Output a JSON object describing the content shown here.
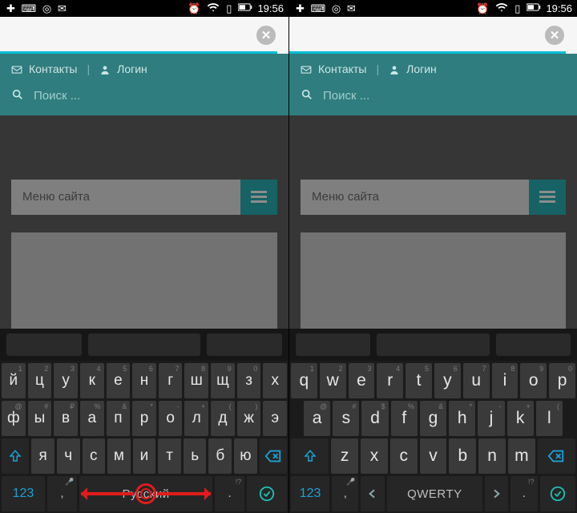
{
  "status": {
    "time": "19:56"
  },
  "header": {
    "contacts": "Контакты",
    "login": "Логин",
    "search_placeholder": "Поиск ..."
  },
  "menu": {
    "title": "Меню сайта"
  },
  "keyboard_ru": {
    "row1_letters": [
      "й",
      "ц",
      "у",
      "к",
      "е",
      "н",
      "г",
      "ш",
      "щ",
      "з",
      "х"
    ],
    "row1_sup": [
      "1",
      "2",
      "3",
      "4",
      "5",
      "6",
      "7",
      "8",
      "9",
      "0",
      ""
    ],
    "row2_letters": [
      "ф",
      "ы",
      "в",
      "а",
      "п",
      "р",
      "о",
      "л",
      "д",
      "ж",
      "э"
    ],
    "row2_sup": [
      "@",
      "#",
      "₽",
      "%",
      "&",
      "*",
      "-",
      "+",
      "(",
      ")",
      ""
    ],
    "row3_letters": [
      "я",
      "ч",
      "с",
      "м",
      "и",
      "т",
      "ь",
      "б",
      "ю"
    ],
    "row3_sup": [
      "",
      "",
      "",
      "",
      "",
      "",
      "",
      "",
      ""
    ],
    "fn123": "123",
    "comma": ",",
    "space_label": "Русский",
    "period": ".",
    "question_sup": "!?"
  },
  "keyboard_en": {
    "row1_letters": [
      "q",
      "w",
      "e",
      "r",
      "t",
      "y",
      "u",
      "i",
      "o",
      "p"
    ],
    "row1_sup": [
      "1",
      "2",
      "3",
      "4",
      "5",
      "6",
      "7",
      "8",
      "9",
      "0"
    ],
    "row2_letters": [
      "a",
      "s",
      "d",
      "f",
      "g",
      "h",
      "j",
      "k",
      "l"
    ],
    "row2_sup": [
      "@",
      "#",
      "$",
      "%",
      "&",
      "*",
      "-",
      "+",
      "("
    ],
    "row3_letters": [
      "z",
      "x",
      "c",
      "v",
      "b",
      "n",
      "m"
    ],
    "row3_sup": [
      "",
      "",
      "",
      "",
      "",
      "",
      ""
    ],
    "fn123": "123",
    "comma": ",",
    "space_label": "QWERTY",
    "period": ".",
    "question_sup": "!?"
  }
}
